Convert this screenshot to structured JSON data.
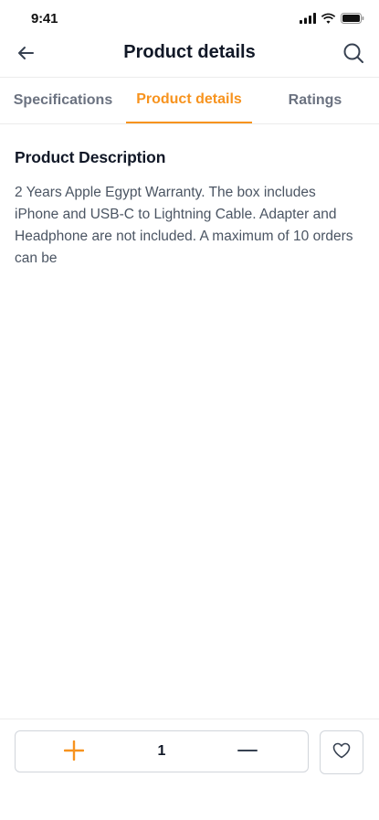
{
  "status_bar": {
    "time": "9:41"
  },
  "header": {
    "title": "Product details",
    "back_icon": "arrow-left-icon",
    "search_icon": "search-icon"
  },
  "tabs": [
    {
      "label": "Specifications",
      "active": false
    },
    {
      "label": "Product details",
      "active": true
    },
    {
      "label": "Ratings",
      "active": false
    }
  ],
  "content": {
    "section_title": "Product Description",
    "description": "2 Years Apple Egypt Warranty. The box includes iPhone and USB-C to Lightning Cable. Adapter and Headphone are not included. A maximum of 10 orders can be"
  },
  "bottom_bar": {
    "quantity": "1",
    "plus_icon": "plus-icon",
    "minus_icon": "minus-icon",
    "favorite_icon": "heart-icon"
  },
  "colors": {
    "accent": "#f7931e",
    "text_primary": "#111827",
    "text_secondary": "#4b5563",
    "tab_inactive": "#6b7280",
    "border": "#d1d5db",
    "divider": "#ececec"
  }
}
